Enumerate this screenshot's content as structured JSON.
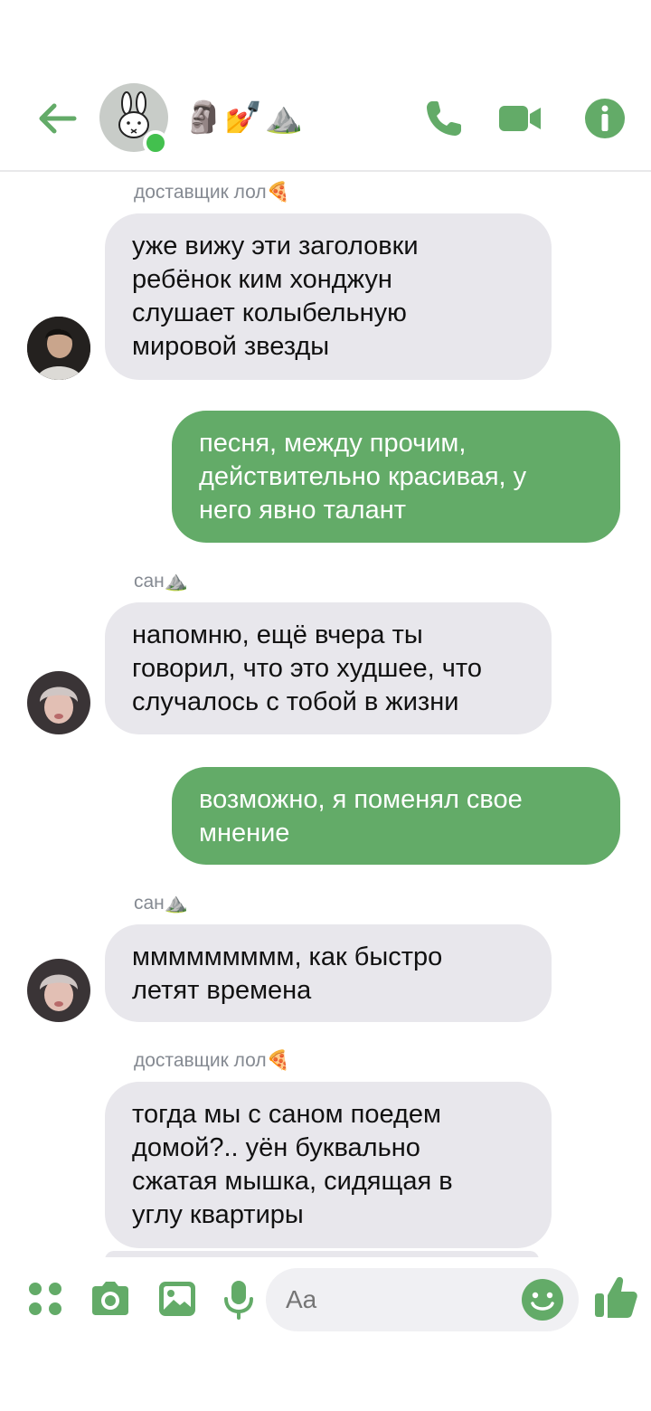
{
  "header": {
    "title": "🗿💅⛰️"
  },
  "messages": [
    {
      "sender": "доставщик лол🍕",
      "lines": [
        " уже вижу эти заголовки",
        "ребёнок ким хонджун",
        "слушает колыбельную",
        "мировой звезды"
      ]
    },
    {
      "lines": [
        "песня, между прочим,",
        "действительно красивая, у",
        "него явно талант"
      ]
    },
    {
      "sender": "сан⛰️",
      "lines": [
        "напомню, ещё вчера ты",
        "говорил, что это худшее, что",
        "случалось с тобой в жизни"
      ]
    },
    {
      "lines": [
        "возможно, я поменял свое",
        "мнение"
      ]
    },
    {
      "sender": "сан⛰️",
      "lines": [
        "ммммммммм, как быстро",
        "летят времена"
      ]
    },
    {
      "sender": "доставщик лол🍕",
      "lines": [
        "тогда мы с саном поедем",
        "домой?.. уён буквально",
        "сжатая мышка, сидящая в",
        "углу квартиры"
      ]
    }
  ],
  "composer": {
    "placeholder": "Aa"
  },
  "colors": {
    "accent": "#63ab68",
    "incoming_bubble": "#e8e7ec",
    "online": "#43c04e"
  }
}
